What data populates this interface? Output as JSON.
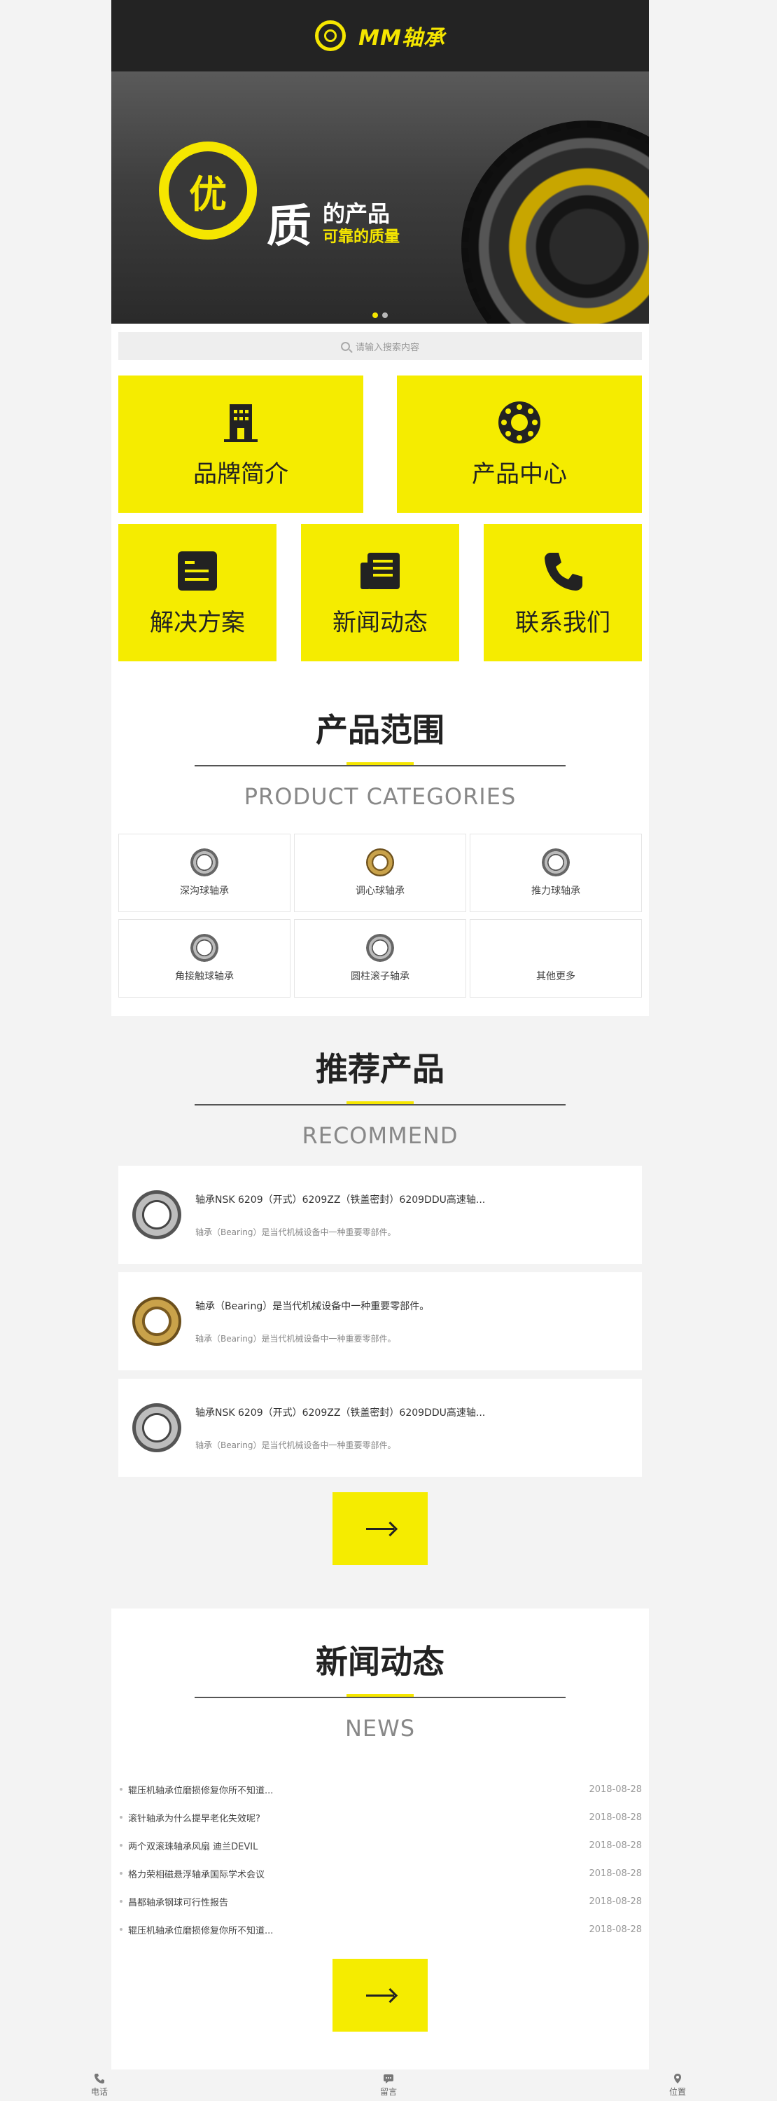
{
  "header": {
    "logo_text": "MM轴承"
  },
  "banner": {
    "badge_char": "优",
    "headline_char": "质",
    "subhead": "的产品",
    "tagline": "可靠的质量",
    "slide_count": 2,
    "active_slide": 1
  },
  "search": {
    "placeholder": "请输入搜索内容"
  },
  "tiles": [
    {
      "label": "品牌简介",
      "icon": "building-icon"
    },
    {
      "label": "产品中心",
      "icon": "bearing-icon"
    },
    {
      "label": "解决方案",
      "icon": "document-icon"
    },
    {
      "label": "新闻动态",
      "icon": "newspaper-icon"
    },
    {
      "label": "联系我们",
      "icon": "phone-icon"
    }
  ],
  "categories": {
    "title": "产品范围",
    "subtitle": "PRODUCT CATEGORIES",
    "items": [
      {
        "label": "深沟球轴承"
      },
      {
        "label": "调心球轴承"
      },
      {
        "label": "推力球轴承"
      },
      {
        "label": "角接触球轴承"
      },
      {
        "label": "圆柱滚子轴承"
      },
      {
        "label": "其他更多"
      }
    ]
  },
  "recommend": {
    "title": "推荐产品",
    "subtitle": "RECOMMEND",
    "items": [
      {
        "title": "轴承NSK 6209（开式）6209ZZ（铁盖密封）6209DDU高速轴...",
        "desc": "轴承（Bearing）是当代机械设备中一种重要零部件。"
      },
      {
        "title": "轴承（Bearing）是当代机械设备中一种重要零部件。",
        "desc": "轴承（Bearing）是当代机械设备中一种重要零部件。"
      },
      {
        "title": "轴承NSK 6209（开式）6209ZZ（铁盖密封）6209DDU高速轴...",
        "desc": "轴承（Bearing）是当代机械设备中一种重要零部件。"
      }
    ]
  },
  "news": {
    "title": "新闻动态",
    "subtitle": "NEWS",
    "items": [
      {
        "title": "辊压机轴承位磨损修复你所不知道...",
        "date": "2018-08-28"
      },
      {
        "title": "滚针轴承为什么提早老化失效呢?",
        "date": "2018-08-28"
      },
      {
        "title": "两个双滚珠轴承风扇 迪兰DEVIL",
        "date": "2018-08-28"
      },
      {
        "title": "格力荣相磁悬浮轴承国际学术会议",
        "date": "2018-08-28"
      },
      {
        "title": "昌都轴承钢球可行性报告",
        "date": "2018-08-28"
      },
      {
        "title": "辊压机轴承位磨损修复你所不知道...",
        "date": "2018-08-28"
      }
    ]
  },
  "bottom_nav": [
    {
      "label": "电话",
      "icon": "phone-icon"
    },
    {
      "label": "留言",
      "icon": "message-icon"
    },
    {
      "label": "位置",
      "icon": "location-icon"
    }
  ],
  "colors": {
    "accent": "#f5ec00",
    "dark": "#232323"
  }
}
